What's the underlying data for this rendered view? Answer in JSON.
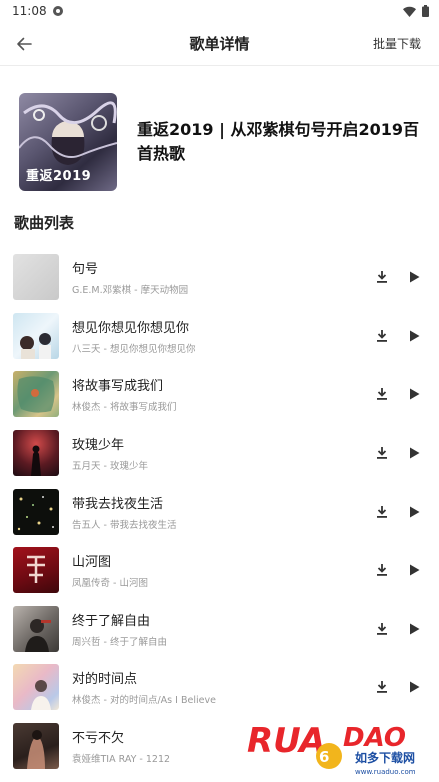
{
  "status": {
    "time": "11:08"
  },
  "header": {
    "title": "歌单详情",
    "batch_download": "批量下载"
  },
  "playlist": {
    "cover_text": "重返2019",
    "title": "重返2019 | 从邓紫棋句号开启2019百首热歌"
  },
  "section_title": "歌曲列表",
  "songs": [
    {
      "title": "句号",
      "subtitle": "G.E.M.邓紫棋 - 摩天动物园"
    },
    {
      "title": "想见你想见你想见你",
      "subtitle": "八三夭 - 想见你想见你想见你"
    },
    {
      "title": "将故事写成我们",
      "subtitle": "林俊杰 - 将故事写成我们"
    },
    {
      "title": "玫瑰少年",
      "subtitle": "五月天 - 玫瑰少年"
    },
    {
      "title": "带我去找夜生活",
      "subtitle": "告五人 - 带我去找夜生活"
    },
    {
      "title": "山河图",
      "subtitle": "凤凰传奇 - 山河图"
    },
    {
      "title": "终于了解自由",
      "subtitle": "周兴哲 - 终于了解自由"
    },
    {
      "title": "对的时间点",
      "subtitle": "林俊杰 - 对的时间点/As I Believe"
    },
    {
      "title": "不亏不欠",
      "subtitle": "袁娅维TIA RAY - 1212"
    }
  ],
  "watermark": {
    "brand": "RUANDAO",
    "tagline": "如多下载网",
    "url": "www.ruaduo.com"
  },
  "icons": {
    "back": "arrow-left-icon",
    "download": "download-icon",
    "play": "play-icon"
  },
  "colors": {
    "title": "#222222",
    "subtitle": "#999999",
    "icon": "#333333",
    "watermark_red": "#e8262b",
    "watermark_blue": "#1d4fa3",
    "watermark_yellow": "#f2b51c"
  }
}
